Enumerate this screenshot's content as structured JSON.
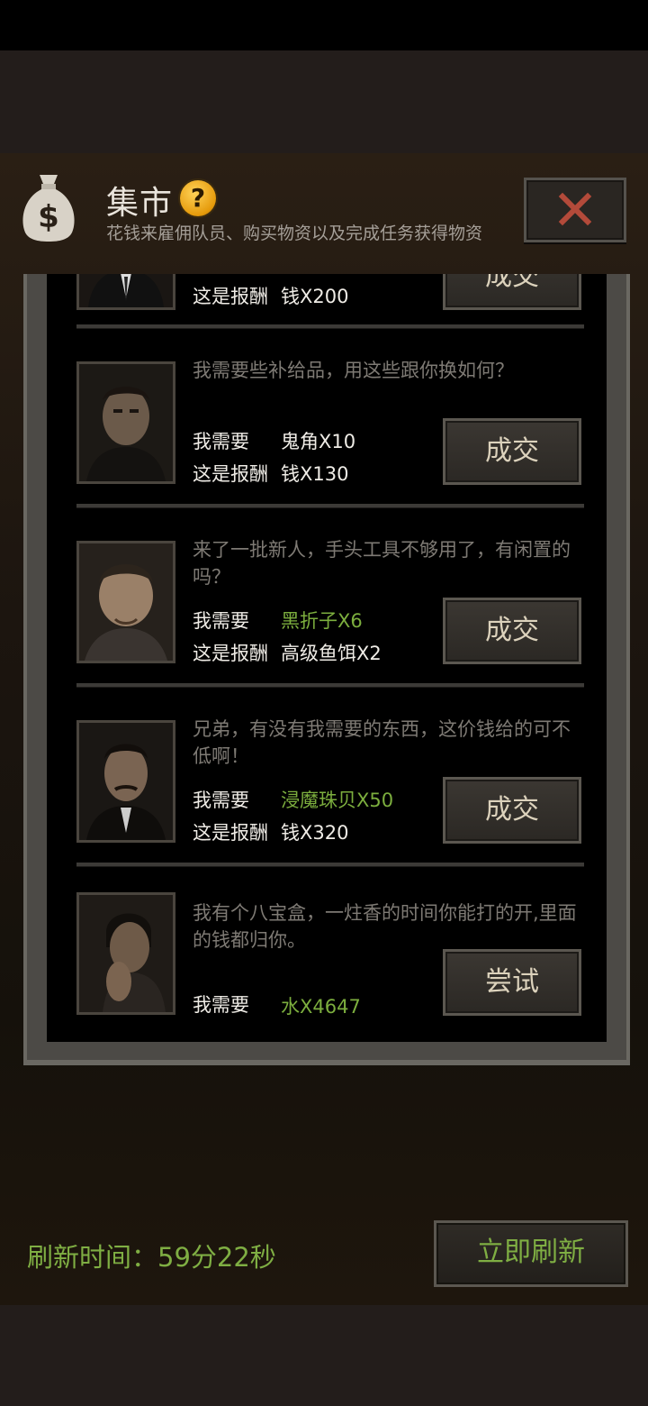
{
  "header": {
    "title": "集市",
    "help_symbol": "?",
    "subtitle": "花钱来雇佣队员、购买物资以及完成任务获得物资",
    "icons": {
      "bag": "money-bag-icon",
      "help": "help-icon",
      "close": "close-icon"
    }
  },
  "colors": {
    "accent_green": "#7cae3e",
    "close_red": "#b34a3a",
    "help_orange": "#f0a318"
  },
  "trades": [
    {
      "dialogue": "",
      "need_label": "",
      "need_value": "",
      "reward_label": "这是报酬",
      "reward_value": "钱X200",
      "button": "成交"
    },
    {
      "dialogue": "我需要些补给品，用这些跟你换如何？",
      "need_label": "我需要",
      "need_value": "鬼角X10",
      "reward_label": "这是报酬",
      "reward_value": "钱X130",
      "button": "成交"
    },
    {
      "dialogue": "来了一批新人，手头工具不够用了，有闲置的吗？",
      "need_label": "我需要",
      "need_value": "黑折子X6",
      "reward_label": "这是报酬",
      "reward_value": "高级鱼饵X2",
      "button": "成交"
    },
    {
      "dialogue": "兄弟，有没有我需要的东西，这价钱给的可不低啊！",
      "need_label": "我需要",
      "need_value": "浸魔珠贝X50",
      "reward_label": "这是报酬",
      "reward_value": "钱X320",
      "button": "成交"
    },
    {
      "dialogue": "我有个八宝盒，一炷香的时间你能打的开,里面的钱都归你。",
      "need_label": "我需要",
      "need_value": "水X4647",
      "reward_label": "",
      "reward_value": "",
      "button": "尝试"
    }
  ],
  "footer": {
    "refresh_time": "刷新时间：59分22秒",
    "refresh_button": "立即刷新"
  }
}
